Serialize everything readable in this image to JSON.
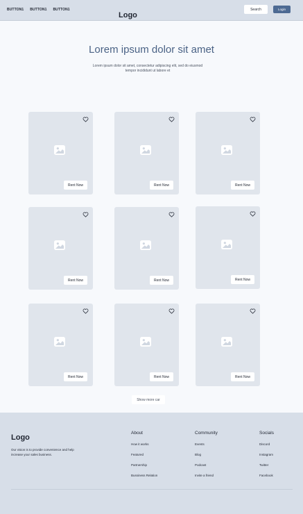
{
  "header": {
    "nav_buttons": [
      "BUTTON1",
      "BUTTON1",
      "BUTTON1"
    ],
    "logo": "Logo",
    "search_label": "Search",
    "login_label": "Login"
  },
  "hero": {
    "title": "Lorem ipsum dolor sit amet",
    "subtitle": "Lorem ipsum dolor sit amet, consectetur adipiscing elit, sed do eiusmod tempor incididunt ut labore et"
  },
  "cards": [
    {
      "button": "Rent Now"
    },
    {
      "button": "Rent Now"
    },
    {
      "button": "Rent Now"
    },
    {
      "button": "Rent Now"
    },
    {
      "button": "Rent Now"
    },
    {
      "button": "Rent Now"
    },
    {
      "button": "Rent Now"
    },
    {
      "button": "Rent Now"
    },
    {
      "button": "Rent Now"
    }
  ],
  "show_more_label": "Show more car",
  "footer": {
    "logo": "Logo",
    "vision": "Our vision is to provide convenience and help increase your sales business.",
    "columns": [
      {
        "title": "About",
        "links": [
          "How it works",
          "Featured",
          "Partnership",
          "Bussiness Relation"
        ]
      },
      {
        "title": "Community",
        "links": [
          "Events",
          "Blog",
          "Podcast",
          "Invite a friend"
        ]
      },
      {
        "title": "Socials",
        "links": [
          "Discord",
          "Instagram",
          "Twitter",
          "Facebook"
        ]
      }
    ]
  },
  "colors": {
    "header_bg": "#d7dee8",
    "card_bg": "#e0e5ec",
    "accent": "#4d6a93",
    "title": "#4a6285"
  },
  "icons": [
    "heart-icon",
    "image-placeholder-icon"
  ]
}
